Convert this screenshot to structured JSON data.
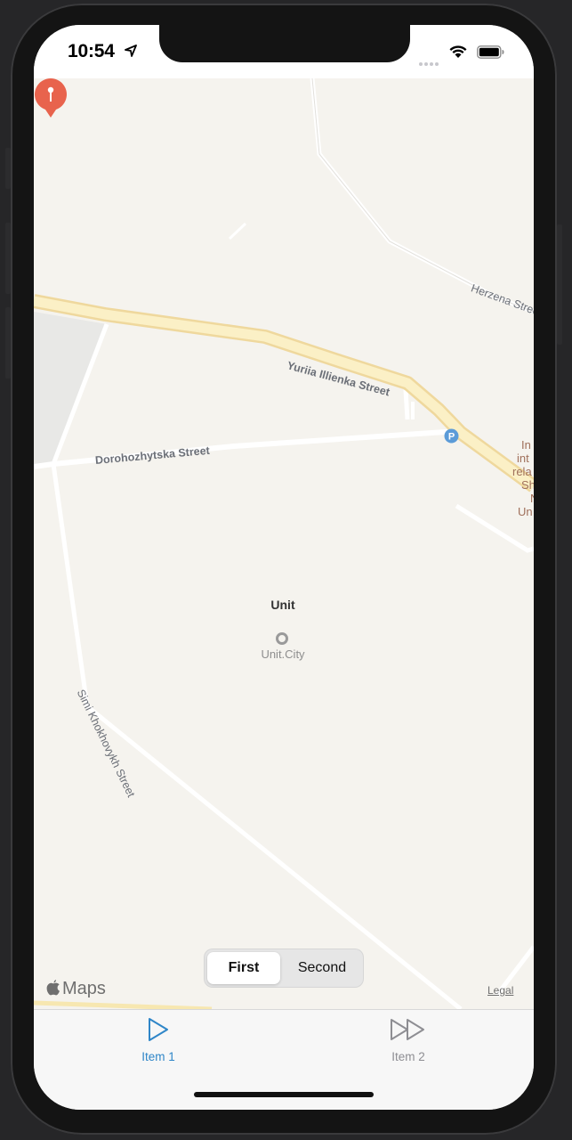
{
  "status_bar": {
    "time": "10:54"
  },
  "map": {
    "pin": {
      "label": "Unit",
      "color": "#e8634d"
    },
    "poi": {
      "label": "Unit.City"
    },
    "roads": {
      "yuriia": "Yuriia Illienka Street",
      "dorohozhytska": "Dorohozhytska Street",
      "simi": "Simi Khokhovykh Street",
      "herzena": "Herzena Street"
    },
    "side_poi_lines": [
      "In",
      "int",
      "rela",
      "Sh",
      "N",
      "Un"
    ],
    "parking_icon": "P",
    "brand": "Maps",
    "legal": "Legal"
  },
  "segmented_control": {
    "options": [
      "First",
      "Second"
    ],
    "selected": "First"
  },
  "tab_bar": {
    "items": [
      {
        "label": "Item 1",
        "icon": "play-icon",
        "active": true
      },
      {
        "label": "Item 2",
        "icon": "fast-forward-icon",
        "active": false
      }
    ],
    "accent_color": "#2f86c8"
  }
}
